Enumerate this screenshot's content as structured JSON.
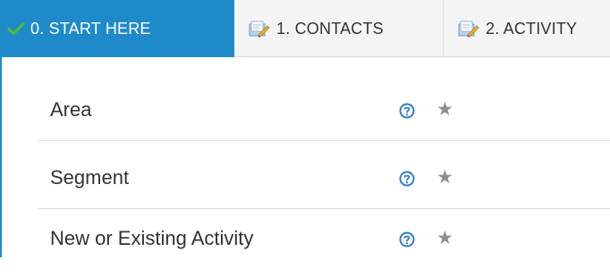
{
  "tabs": [
    {
      "label": "0. START HERE",
      "icon": "check-icon",
      "active": true
    },
    {
      "label": "1. CONTACTS",
      "icon": "document-edit-icon",
      "active": false
    },
    {
      "label": "2. ACTIVITY",
      "icon": "document-edit-icon",
      "active": false
    }
  ],
  "fields": [
    {
      "label": "Area",
      "help_icon": "help-icon",
      "star_icon": "star-icon"
    },
    {
      "label": "Segment",
      "help_icon": "help-icon",
      "star_icon": "star-icon"
    },
    {
      "label": "New or Existing Activity",
      "help_icon": "help-icon",
      "star_icon": "star-icon"
    }
  ],
  "colors": {
    "accent": "#1f8ac9",
    "tab_bar": "#f4f4f4",
    "help": "#2f7fc8",
    "star": "#8f8f8f"
  },
  "glyphs": {
    "star": "★"
  }
}
